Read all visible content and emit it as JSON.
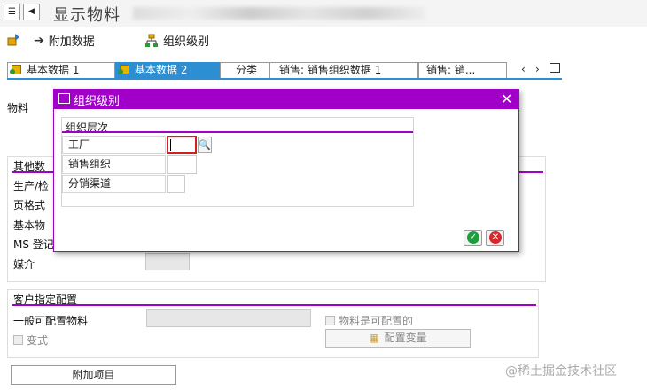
{
  "window": {
    "title": "显示物料"
  },
  "toolbar": {
    "additional_data": "附加数据",
    "org_levels": "组织级别"
  },
  "tabs": [
    {
      "label": "基本数据 1"
    },
    {
      "label": "基本数据 2"
    },
    {
      "label": "分类"
    },
    {
      "label": "销售: 销售组织数据 1"
    },
    {
      "label": "销售: 销..."
    }
  ],
  "form": {
    "material_label": "物料",
    "other_data_section": "其他数",
    "rows": [
      {
        "label": "生产/检"
      },
      {
        "label": "页格式"
      },
      {
        "label": "基本物"
      },
      {
        "label": "MS 登记"
      },
      {
        "label": "媒介"
      }
    ],
    "config_section": "客户指定配置",
    "general_configurable": "一般可配置物料",
    "material_configurable": "物料是可配置的",
    "variant": "变式",
    "config_variants": "配置变量",
    "additional_items": "附加项目"
  },
  "dialog": {
    "title": "组织级别",
    "group_title": "组织层次",
    "fields": [
      {
        "label": "工厂",
        "value": ""
      },
      {
        "label": "销售组织",
        "value": ""
      },
      {
        "label": "分销渠道",
        "value": ""
      }
    ]
  },
  "watermark": "@稀土掘金技术社区",
  "colors": {
    "accent": "#a000c8",
    "tab_active": "#2d8fd2"
  }
}
